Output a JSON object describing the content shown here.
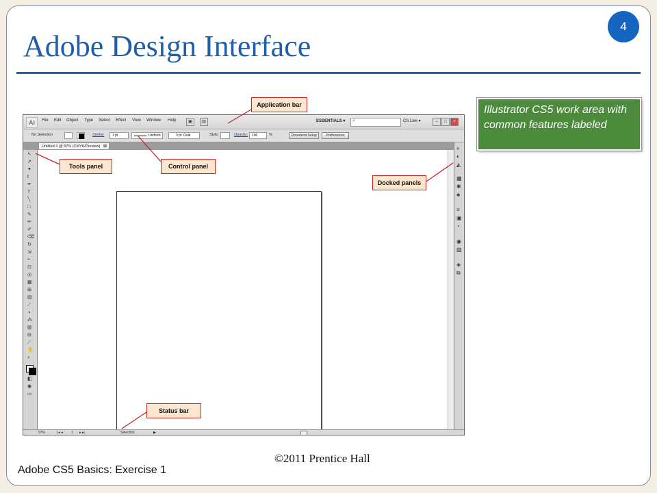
{
  "slide": {
    "title": "Adobe Design Interface",
    "page_number": "4",
    "note": "Illustrator CS5 work area with common features labeled",
    "footer_left": "Adobe CS5 Basics: Exercise 1",
    "footer_center": "©2011 Prentice Hall",
    "colors": {
      "title": "#1f5fa8",
      "badge": "#1565c0",
      "note_bg": "#4c8a3c",
      "label_bg": "#fde6cf",
      "label_border": "#cc2222"
    }
  },
  "callouts": {
    "application_bar": "Application bar",
    "tools_panel": "Tools panel",
    "control_panel": "Control panel",
    "docked_panels": "Docked panels",
    "status_bar": "Status bar"
  },
  "illustrator": {
    "logo": "Ai",
    "menus": [
      "File",
      "Edit",
      "Object",
      "Type",
      "Select",
      "Effect",
      "View",
      "Window",
      "Help"
    ],
    "workspace": "ESSENTIALS ▾",
    "cs_live": "CS Live ▾",
    "control": {
      "selection_label": "No Selection",
      "stroke_label": "Stroke:",
      "stroke_value": "1 pt",
      "profile": "Uniform",
      "brush": "3 pt. Oval",
      "style_label": "Style:",
      "opacity_label": "Opacity:",
      "opacity_value": "100",
      "percent": "%",
      "doc_setup_button": "Document Setup",
      "preferences_button": "Preferences"
    },
    "document_tab": "Untitled-1 @ 97% (CMYK/Preview)",
    "status": {
      "zoom": "97%",
      "page": "1",
      "tool": "Selection"
    }
  }
}
